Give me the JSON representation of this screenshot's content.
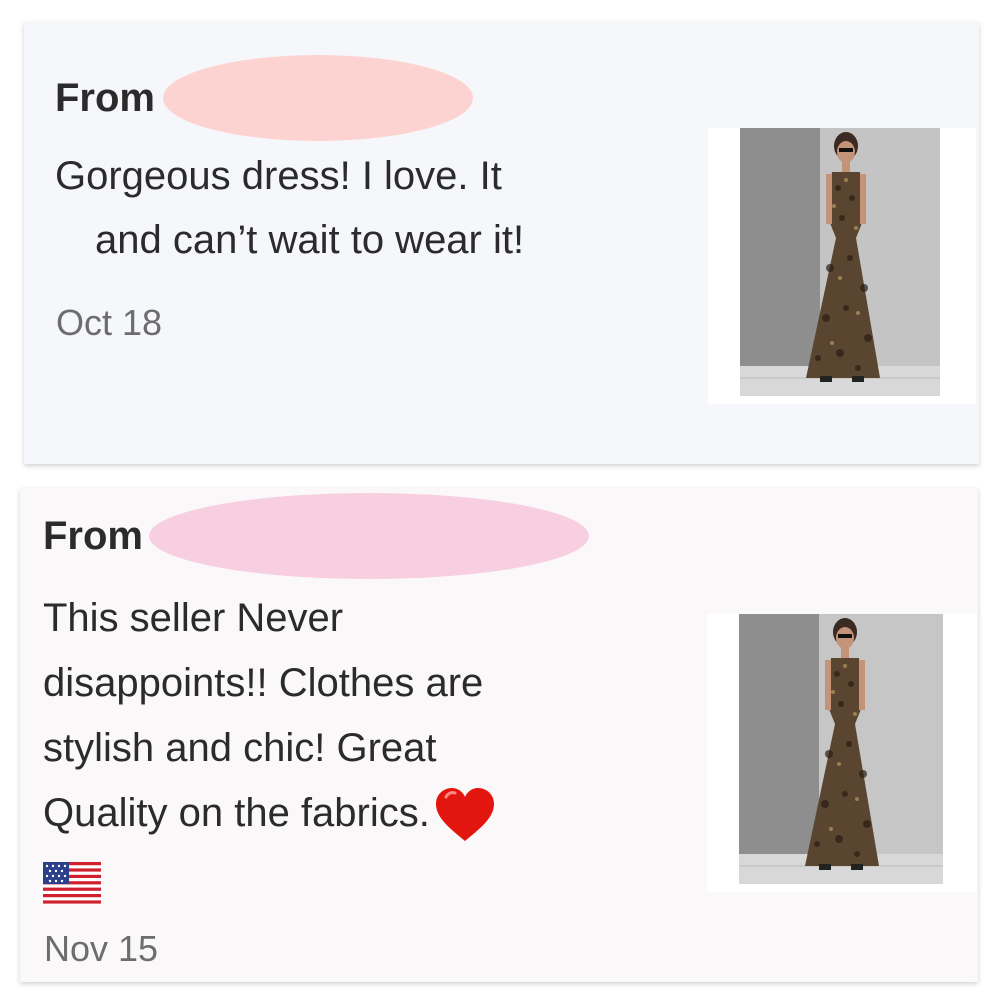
{
  "reviews": [
    {
      "from_label": "From",
      "text_lines": [
        "Gorgeous dress!  I love. It",
        "and can’t wait to wear it!"
      ],
      "date": "Oct 18",
      "redaction_color": "#fdd3d1",
      "photo_icon": "dress-photo"
    },
    {
      "from_label": "From",
      "text_lines": [
        "This seller Never",
        "disappoints!! Clothes are",
        "stylish and chic! Great",
        "Quality on the fabrics."
      ],
      "emojis": [
        "heart-icon",
        "us-flag-icon"
      ],
      "date": "Nov 15",
      "redaction_color": "#f8cfe0",
      "photo_icon": "dress-photo"
    }
  ]
}
